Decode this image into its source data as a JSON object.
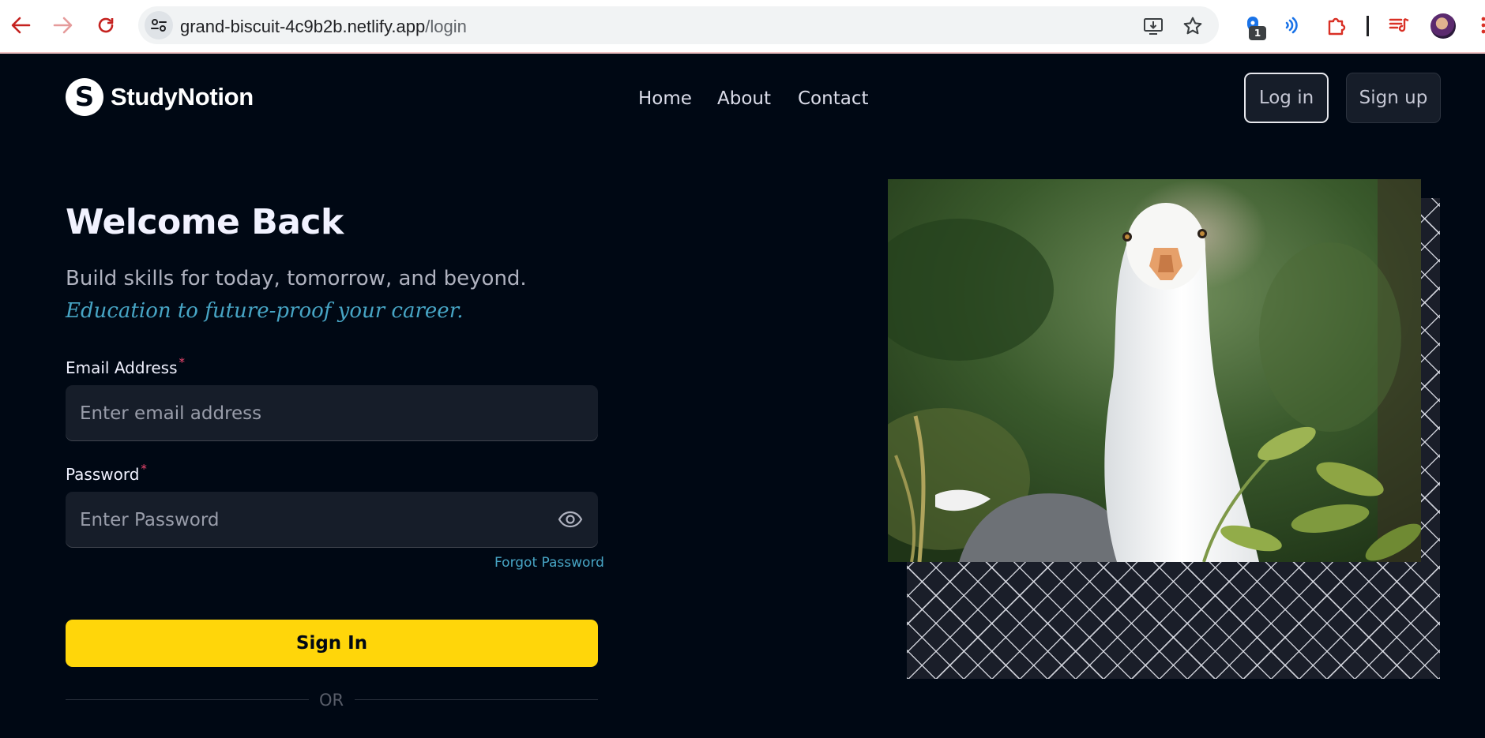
{
  "browser": {
    "url_host": "grand-biscuit-4c9b2b.netlify.app",
    "url_path": "/login",
    "extension_badge": "1"
  },
  "site": {
    "logo_letter": "S",
    "brand_name": "StudyNotion",
    "nav": [
      {
        "label": "Home"
      },
      {
        "label": "About"
      },
      {
        "label": "Contact"
      }
    ],
    "login_label": "Log in",
    "signup_label": "Sign up"
  },
  "form": {
    "title": "Welcome Back",
    "subtitle": "Build skills for today, tomorrow, and beyond.",
    "tagline": "Education to future-proof your career.",
    "email_label": "Email Address",
    "email_placeholder": "Enter email address",
    "password_label": "Password",
    "password_placeholder": "Enter Password",
    "required_mark": "*",
    "forgot_label": "Forgot Password",
    "submit_label": "Sign In",
    "or_label": "OR"
  },
  "colors": {
    "background": "#000814",
    "accent_yellow": "#ffd60a",
    "accent_blue": "#47a5c5",
    "input_bg": "#161d29",
    "required_pink": "#ef476f"
  }
}
